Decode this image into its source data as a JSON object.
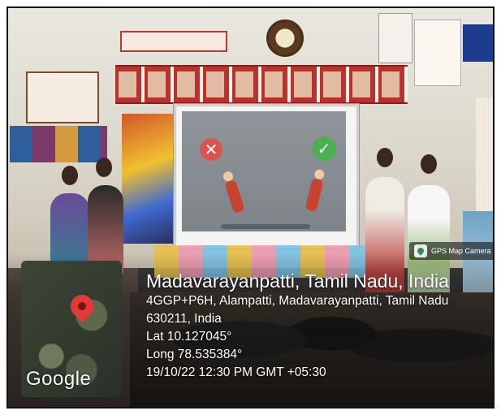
{
  "overlay": {
    "app_badge": "GPS Map Camera",
    "map_brand": "Google",
    "location_title": "Madavarayanpatti, Tamil Nadu, India",
    "address_line1": "4GGP+P6H, Alampatti, Madavarayanpatti, Tamil Nadu",
    "address_line2": "630211, India",
    "latitude": "Lat 10.127045°",
    "longitude": "Long 78.535384°",
    "datetime": "19/10/22 12:30 PM GMT +05:30"
  },
  "projection": {
    "icons": [
      "cross-icon",
      "check-icon"
    ]
  },
  "colors": {
    "pin": "#e53935",
    "cross": "#d9534f",
    "check": "#4caf50"
  }
}
